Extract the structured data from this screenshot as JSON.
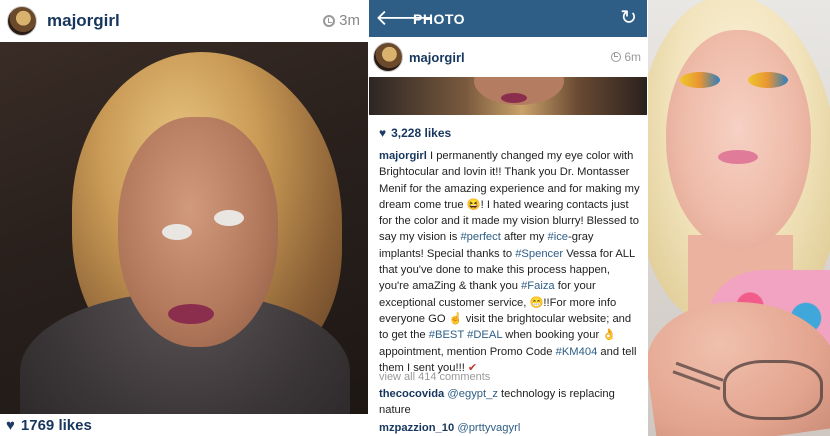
{
  "left_post": {
    "username": "majorgirl",
    "time": "3m",
    "likes": "1769 likes",
    "icons": {
      "clock": "clock-icon",
      "likes": "heart-icon"
    }
  },
  "app": {
    "toolbar": {
      "title": "PHOTO",
      "back_icon": "back-arrow-icon",
      "refresh_icon": "refresh-icon"
    },
    "post": {
      "username": "majorgirl",
      "time": "6m",
      "likes": "3,228 likes"
    },
    "caption": {
      "user": "majorgirl",
      "s1": " I permanently changed my eye color with Brightocular and lovin it!! Thank you Dr. Montasser Menif for the amazing experience and for making my dream come true ",
      "e1": "😆",
      "s2": "! I hated wearing contacts just for the color and it made my vision blurry! Blessed to say my vision is ",
      "t1": "#perfect",
      "s3": " after my ",
      "t2": "#ice",
      "s4": "-gray implants! Special thanks to ",
      "t3": "#Spencer",
      "s5": " Vessa for ALL that you've done to make this process happen, you're amaZing & thank you ",
      "t4": "#Faiza",
      "s6": " for your exceptional customer service, ",
      "e2": "😁",
      "s7": "!!For more info everyone GO ",
      "e3": "☝",
      "s8": " visit the brightocular website; and to get the ",
      "t5": "#BEST",
      "s9": " ",
      "t6": "#DEAL",
      "s10": " when booking your ",
      "e4": "👌",
      "s11": "appointment, mention Promo Code ",
      "t7": "#KM404",
      "s12": " and tell them I sent you!!! ",
      "e5": "✔"
    },
    "view_all": "view all 414 comments",
    "comments": [
      {
        "user": "thecocovida",
        "mention": "@egypt_z",
        "text": " technology is replacing nature"
      },
      {
        "user": "mzpazzion_10",
        "mention": "@prttyvagyrl",
        "text": ""
      }
    ]
  },
  "colors": {
    "toolbar": "#2e5e86",
    "username": "#17365d",
    "hashtag": "#2e5e86"
  }
}
